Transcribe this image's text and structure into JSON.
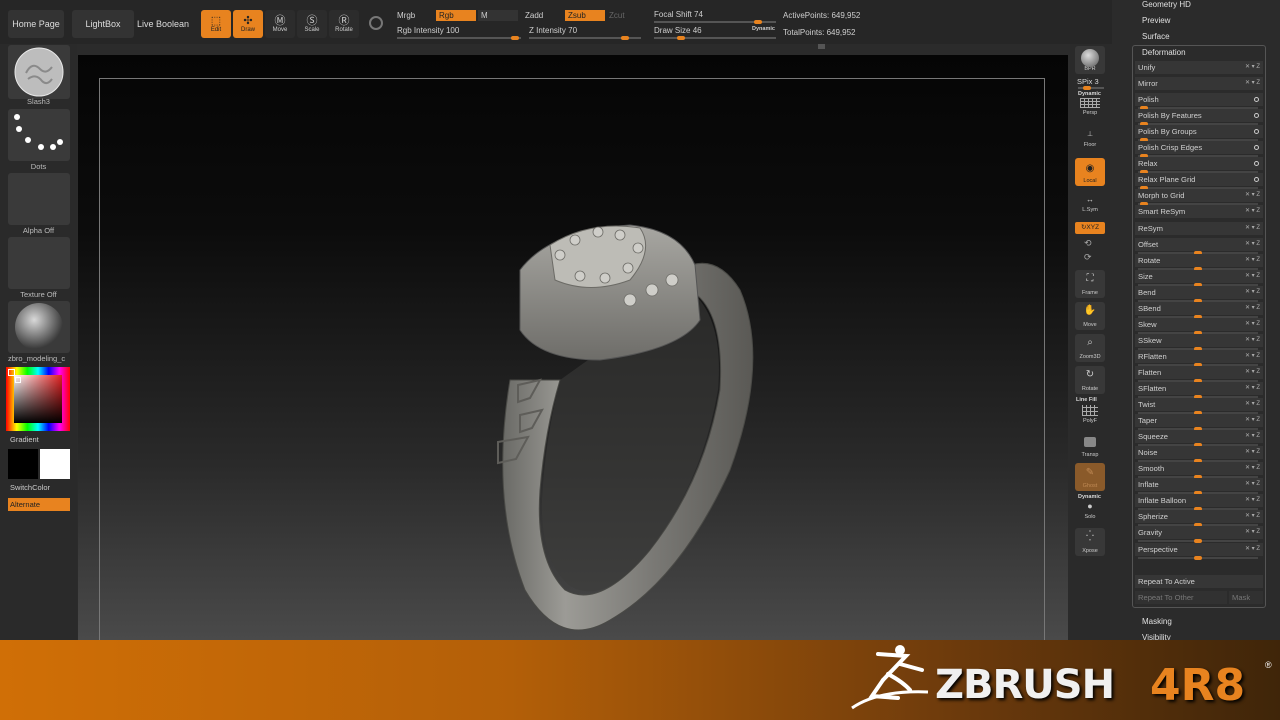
{
  "topbar": {
    "nav": [
      "Home Page",
      "LightBox",
      "Live Boolean"
    ],
    "tools": [
      {
        "label": "Edit",
        "active": true
      },
      {
        "label": "Draw",
        "active": true
      },
      {
        "label": "Move",
        "active": false
      },
      {
        "label": "Scale",
        "active": false
      },
      {
        "label": "Rotate",
        "active": false
      }
    ],
    "mrgb": "Mrgb",
    "rgb": "Rgb",
    "m": "M",
    "zadd": "Zadd",
    "zsub": "Zsub",
    "zcut": "Zcut",
    "rgb_intensity_label": "Rgb Intensity",
    "rgb_intensity": "100",
    "z_intensity_label": "Z Intensity",
    "z_intensity": "70",
    "focal_shift_label": "Focal Shift",
    "focal_shift": "74",
    "draw_size_label": "Draw Size",
    "draw_size": "46",
    "dynamic": "Dynamic",
    "active_points": "ActivePoints: 649,952",
    "total_points": "TotalPoints: 649,952"
  },
  "leftshelf": {
    "brush": "Slash3",
    "stroke": "Dots",
    "alpha": "Alpha Off",
    "texture": "Texture Off",
    "material": "zbro_modeling_c",
    "gradient": "Gradient",
    "switch_color": "SwitchColor",
    "alternate": "Alternate"
  },
  "rightshelf": {
    "bpr": "BPR",
    "spix": "SPix 3",
    "dynamic": "Dynamic",
    "persp": "Persp",
    "floor": "Floor",
    "local": "Local",
    "lsym": "L.Sym",
    "xyz": "↻XYZ",
    "frame": "Frame",
    "move": "Move",
    "zoom3d": "Zoom3D",
    "rotate": "Rotate",
    "linefill": "Line Fill",
    "polyf": "PolyF",
    "transp": "Transp",
    "ghost": "Ghost",
    "dynamic2": "Dynamic",
    "solo": "Solo",
    "xpose": "Xpose"
  },
  "panel": {
    "top_items": [
      "Geometry HD",
      "Preview",
      "Surface"
    ],
    "section": "Deformation",
    "rows": [
      {
        "label": "Unify",
        "kind": "plain"
      },
      {
        "label": "Mirror",
        "kind": "plain"
      },
      {
        "label": "Polish",
        "kind": "dot",
        "value": 0.02
      },
      {
        "label": "Polish By Features",
        "kind": "dot",
        "value": 0.02
      },
      {
        "label": "Polish By Groups",
        "kind": "dot",
        "value": 0.02
      },
      {
        "label": "Polish Crisp Edges",
        "kind": "dot",
        "value": 0.02
      },
      {
        "label": "Relax",
        "kind": "dot",
        "value": 0.02
      },
      {
        "label": "Relax Plane Grid",
        "kind": "dot",
        "value": 0.02
      },
      {
        "label": "Morph to Grid",
        "kind": "bar",
        "value": 0.02
      },
      {
        "label": "Smart ReSym",
        "kind": "plain"
      },
      {
        "label": "ReSym",
        "kind": "plain"
      },
      {
        "label": "Offset",
        "kind": "bar",
        "value": 0.5
      },
      {
        "label": "Rotate",
        "kind": "bar",
        "value": 0.5
      },
      {
        "label": "Size",
        "kind": "bar",
        "value": 0.5
      },
      {
        "label": "Bend",
        "kind": "bar",
        "value": 0.5
      },
      {
        "label": "SBend",
        "kind": "bar",
        "value": 0.5
      },
      {
        "label": "Skew",
        "kind": "bar",
        "value": 0.5
      },
      {
        "label": "SSkew",
        "kind": "bar",
        "value": 0.5
      },
      {
        "label": "RFlatten",
        "kind": "bar",
        "value": 0.5
      },
      {
        "label": "Flatten",
        "kind": "bar",
        "value": 0.5
      },
      {
        "label": "SFlatten",
        "kind": "bar",
        "value": 0.5
      },
      {
        "label": "Twist",
        "kind": "bar",
        "value": 0.5
      },
      {
        "label": "Taper",
        "kind": "bar",
        "value": 0.5
      },
      {
        "label": "Squeeze",
        "kind": "bar",
        "value": 0.5
      },
      {
        "label": "Noise",
        "kind": "bar",
        "value": 0.5
      },
      {
        "label": "Smooth",
        "kind": "bar",
        "value": 0.5
      },
      {
        "label": "Inflate",
        "kind": "bar",
        "value": 0.5
      },
      {
        "label": "Inflate Balloon",
        "kind": "bar",
        "value": 0.5
      },
      {
        "label": "Spherize",
        "kind": "bar",
        "value": 0.5
      },
      {
        "label": "Gravity",
        "kind": "bar",
        "value": 0.5
      },
      {
        "label": "Perspective",
        "kind": "bar",
        "value": 0.5
      }
    ],
    "repeat_active": "Repeat To Active",
    "repeat_other": "Repeat To Other",
    "mask": "Mask",
    "bottom_items": [
      "Masking",
      "Visibility"
    ]
  },
  "banner": {
    "logo_text": "ZBRUSH",
    "version": "4R8",
    "reg": "®"
  },
  "colors": {
    "accent": "#e8831f",
    "panel_bg": "#2b2b2b"
  }
}
